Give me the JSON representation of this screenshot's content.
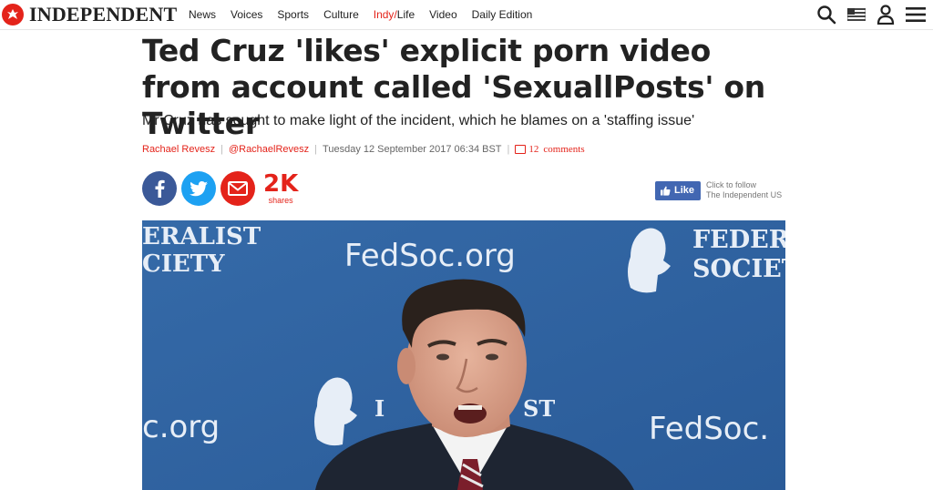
{
  "site": {
    "logo_text": "INDEPENDENT",
    "brand_color": "#e4231a"
  },
  "nav": {
    "items": [
      {
        "label": "News"
      },
      {
        "label": "Voices"
      },
      {
        "label": "Sports"
      },
      {
        "label": "Culture"
      },
      {
        "label_a": "Indy",
        "label_sep": "/",
        "label_b": "Life"
      },
      {
        "label": "Video"
      },
      {
        "label": "Daily Edition"
      }
    ]
  },
  "tools": {
    "icons": [
      "search-icon",
      "edition-flag-icon",
      "account-icon",
      "menu-icon"
    ]
  },
  "article": {
    "headline": "Ted Cruz 'likes' explicit porn video from account called 'SexuallPosts' on Twitter",
    "standfirst": "Mr Cruz has sought to make light of the incident, which he blames on a 'staffing issue'",
    "author": "Rachael Revesz",
    "author_handle": "@RachaelRevesz",
    "date": "Tuesday 12 September 2017 06:34 BST",
    "comments_count": "12",
    "comments_label": "comments"
  },
  "share": {
    "count": "2K",
    "count_label": "shares",
    "colors": {
      "facebook": "#3b5998",
      "twitter": "#1da1f2",
      "email": "#e4231a"
    }
  },
  "follow": {
    "like_label": "Like",
    "line1": "Click to follow",
    "line2": "The Independent US"
  },
  "photo": {
    "backdrop_texts": {
      "top_left_line1": "ERALIST",
      "top_left_line2": "CIETY",
      "top_center": "FedSoc.org",
      "top_right_line1": "FEDERA",
      "top_right_line2": "SOCIETY",
      "mid_left": "c.org",
      "mid_center_line1": "I",
      "mid_center_line2": "ST",
      "mid_right": "FedSoc."
    }
  }
}
